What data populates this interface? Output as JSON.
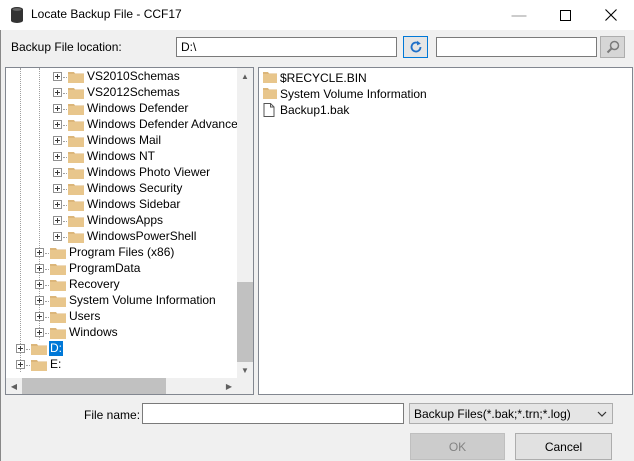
{
  "window": {
    "title": "Locate Backup File - CCF17",
    "minimize_glyph": "—",
    "maximize_glyph": "☐",
    "close_glyph": "✕"
  },
  "location": {
    "label": "Backup File location:",
    "value": "D:\\",
    "search_value": ""
  },
  "tree": {
    "items": [
      {
        "label": "VS2010Schemas",
        "level": 2
      },
      {
        "label": "VS2012Schemas",
        "level": 2
      },
      {
        "label": "Windows Defender",
        "level": 2
      },
      {
        "label": "Windows Defender Advanced T",
        "level": 2
      },
      {
        "label": "Windows Mail",
        "level": 2
      },
      {
        "label": "Windows NT",
        "level": 2
      },
      {
        "label": "Windows Photo Viewer",
        "level": 2
      },
      {
        "label": "Windows Security",
        "level": 2
      },
      {
        "label": "Windows Sidebar",
        "level": 2
      },
      {
        "label": "WindowsApps",
        "level": 2
      },
      {
        "label": "WindowsPowerShell",
        "level": 2
      },
      {
        "label": "Program Files (x86)",
        "level": 1
      },
      {
        "label": "ProgramData",
        "level": 1
      },
      {
        "label": "Recovery",
        "level": 1
      },
      {
        "label": "System Volume Information",
        "level": 1
      },
      {
        "label": "Users",
        "level": 1
      },
      {
        "label": "Windows",
        "level": 1
      },
      {
        "label": "D:",
        "level": 0,
        "selected": true
      },
      {
        "label": "E:",
        "level": 0
      }
    ]
  },
  "files": {
    "items": [
      {
        "label": "$RECYCLE.BIN",
        "icon": "folder-icon"
      },
      {
        "label": "System Volume Information",
        "icon": "folder-icon"
      },
      {
        "label": "Backup1.bak",
        "icon": "file-icon"
      }
    ]
  },
  "bottom": {
    "file_name_label": "File name:",
    "file_name_value": "",
    "filter_selected": "Backup Files(*.bak;*.trn;*.log)",
    "ok_label": "OK",
    "cancel_label": "Cancel"
  },
  "colors": {
    "folder": "#dcb67a",
    "selection": "#0078d7",
    "accent_border": "#0078d7"
  }
}
